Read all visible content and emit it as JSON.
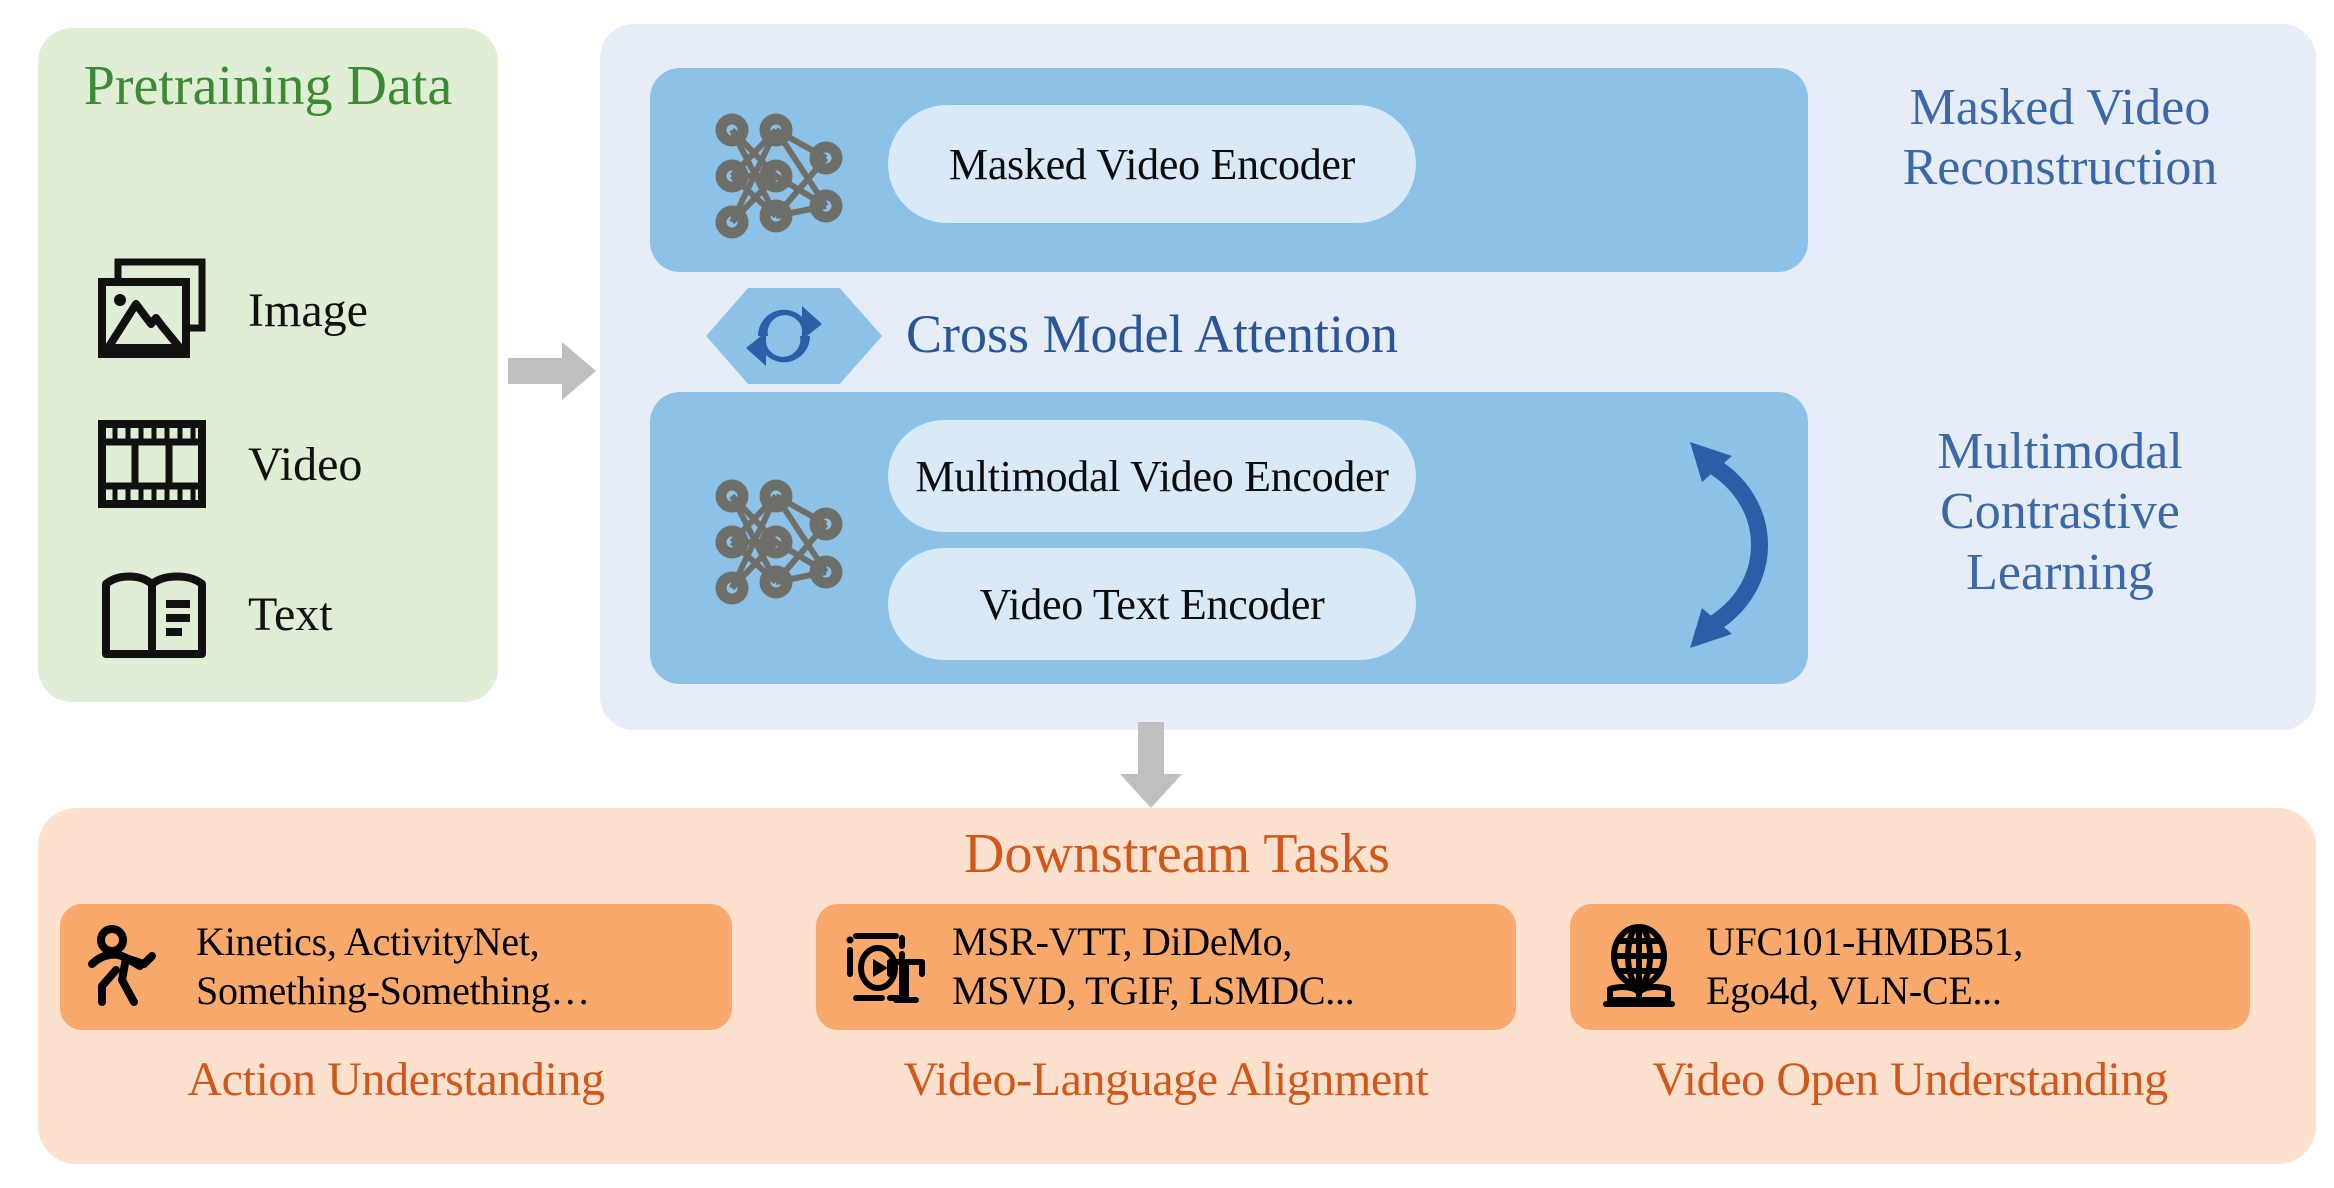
{
  "pretraining": {
    "title": "Pretraining Data",
    "items": [
      {
        "label": "Image",
        "icon": "image-stack-icon"
      },
      {
        "label": "Video",
        "icon": "film-strip-icon"
      },
      {
        "label": "Text",
        "icon": "open-book-icon"
      }
    ]
  },
  "model": {
    "masked_video_reconstruction": {
      "side_title": "Masked Video Reconstruction",
      "encoder": "Masked Video Encoder",
      "nn_icon": "neural-network-icon"
    },
    "cross_model_attention": {
      "label": "Cross Model Attention",
      "icon": "sync-arrows-icon"
    },
    "multimodal_contrastive_learning": {
      "side_title": "Multimodal Contrastive Learning",
      "encoders": [
        "Multimodal Video Encoder",
        "Video Text Encoder"
      ],
      "nn_icon": "neural-network-icon",
      "link_icon": "bidirectional-curved-arrow-icon"
    }
  },
  "flow": {
    "arrow_right": "right-arrow-icon",
    "arrow_down": "down-arrow-icon"
  },
  "downstream": {
    "title": "Downstream Tasks",
    "tasks": [
      {
        "icon": "running-person-icon",
        "datasets": "Kinetics, ActivityNet, Something-Something…",
        "datasets_line1": "Kinetics, ActivityNet,",
        "datasets_line2": "Something-Something…",
        "caption": "Action Understanding"
      },
      {
        "icon": "video-to-text-icon",
        "datasets": "MSR-VTT, DiDeMo, MSVD, TGIF, LSMDC...",
        "datasets_line1": "MSR-VTT, DiDeMo,",
        "datasets_line2": "MSVD, TGIF, LSMDC...",
        "caption": "Video-Language Alignment"
      },
      {
        "icon": "globe-book-icon",
        "datasets": "UFC101-HMDB51, Ego4d, VLN-CE...",
        "datasets_line1": "UFC101-HMDB51,",
        "datasets_line2": "Ego4d, VLN-CE...",
        "caption": "Video Open Understanding"
      }
    ]
  },
  "colors": {
    "green_panel": "#dfeed4",
    "green_text": "#3d8a35",
    "model_panel": "#e7edf7",
    "blue_block": "#8cc2e8",
    "pill": "#d9e9f8",
    "blue_text": "#3a68a8",
    "dark_blue": "#2a5fa8",
    "orange_panel": "#fde1cf",
    "orange_card": "#f9a96c",
    "orange_text": "#d2571a",
    "gray_arrow": "#bfbfbf",
    "nn_node": "#6f6f69"
  }
}
